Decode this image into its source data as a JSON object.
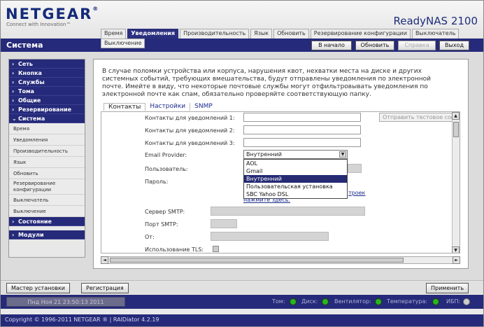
{
  "header": {
    "logo": "NETGEAR",
    "logo_mark": "®",
    "tagline": "Connect with Innovation™",
    "product": "ReadyNAS 2100"
  },
  "tabs": [
    "Время",
    "Уведомления",
    "Производительность",
    "Язык",
    "Обновить",
    "Резервирование конфигурации",
    "Выключатель"
  ],
  "subtab": "Выключение",
  "system_title": "Система",
  "top_buttons": {
    "home": "В начало",
    "refresh": "Обновить",
    "help": "Справка",
    "exit": "Выход"
  },
  "sidebar": {
    "groups_top": [
      "Сеть",
      "Кнопка",
      "Службы",
      "Тома",
      "Общие",
      "Резервирование"
    ],
    "system_group": "Система",
    "system_items": [
      "Время",
      "Уведомления",
      "Производительность",
      "Язык",
      "Обновить",
      "Резервирование конфигурации",
      "Выключатель",
      "Выключение"
    ],
    "status_group": "Состояние",
    "modules_group": "Модули"
  },
  "intro": "В случае поломки устройства или корпуса, нарушения квот, нехватки места на диске и других системных событий, требующих вмешательства, будут отправлены уведомления по электронной почте. Имейте в виду, что некоторые почтовые службы могут отфильтровывать уведомления по электронной почте как спам, обязательно проверяйте соответствующую папку.",
  "content_tabs": [
    "Контакты",
    "Настройки",
    "SNMP"
  ],
  "form": {
    "contact1": "Контакты для уведомлений 1:",
    "contact2": "Контакты для уведомлений 2:",
    "contact3": "Контакты для уведомлений 3:",
    "send_test": "Отправить тестовое сооб",
    "provider_label": "Email Provider:",
    "provider_value": "Внутренний",
    "provider_options": [
      "AOL",
      "Gmail",
      "Внутренний",
      "Пользовательская установка",
      "SBC Yahoo DSL"
    ],
    "provider_selected_index": 2,
    "user_label": "Пользователь:",
    "password_label": "Пароль:",
    "help_link_tail": "троек",
    "help_link": "нажмите здесь.",
    "smtp_server_label": "Сервер SMTP:",
    "smtp_port_label": "Порт SMTP:",
    "from_label": "От:",
    "tls_label": "Использование TLS:"
  },
  "footer": {
    "wizard": "Мастер установки",
    "register": "Регистрация",
    "apply": "Применить"
  },
  "status": {
    "datetime": "Пнд Ноя 21  23:50:13 2011",
    "volume": "Том:",
    "disk": "Диск:",
    "fan": "Вентилятор:",
    "temp": "Температура:",
    "ups": "ИБП:"
  },
  "copyright": "Copyright © 1996-2011 NETGEAR ® | RAIDiator 4.2.19",
  "colors": {
    "brand": "#262a7a",
    "led_ok": "#27b61e",
    "highlight": "#252a73"
  }
}
